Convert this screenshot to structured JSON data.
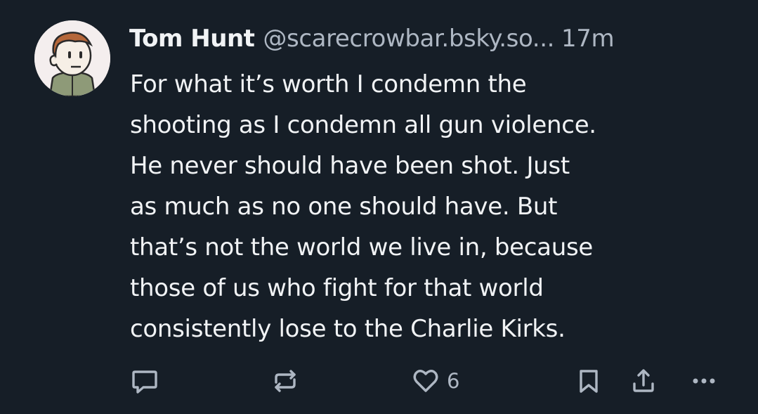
{
  "post": {
    "author_name": "Tom Hunt",
    "author_handle": "@scarecrowbar.bsky.so...",
    "timestamp": "17m",
    "text_lines": [
      "For what it’s worth I condemn the",
      "shooting as I condemn all gun violence.",
      "He never should have been shot. Just",
      "as much as no one should have. But",
      "that’s not the world we live in, because",
      "those of us who fight for that world",
      "consistently lose to the Charlie Kirks."
    ],
    "avatar_icon": "cartoon-avatar-icon"
  },
  "actions": {
    "reply_icon": "reply-icon",
    "repost_icon": "repost-icon",
    "like_icon": "heart-icon",
    "like_count": "6",
    "bookmark_icon": "bookmark-icon",
    "share_icon": "share-icon",
    "more_icon": "more-options-icon"
  },
  "colors": {
    "background": "#161e27",
    "primary_text": "#f1f3f5",
    "secondary_text": "#aeb7c3"
  }
}
